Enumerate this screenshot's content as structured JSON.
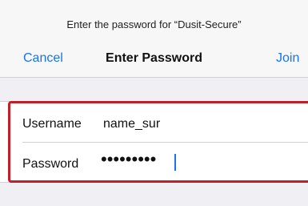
{
  "header": {
    "prompt": "Enter the password for “Dusit-Secure”",
    "cancel_label": "Cancel",
    "title": "Enter Password",
    "join_label": "Join"
  },
  "form": {
    "username_label": "Username",
    "username_value": "name_sur",
    "password_label": "Password",
    "password_mask": "•••••••••"
  },
  "colors": {
    "accent": "#1a73e8",
    "highlight": "#c0202a",
    "background": "#efeff4"
  }
}
